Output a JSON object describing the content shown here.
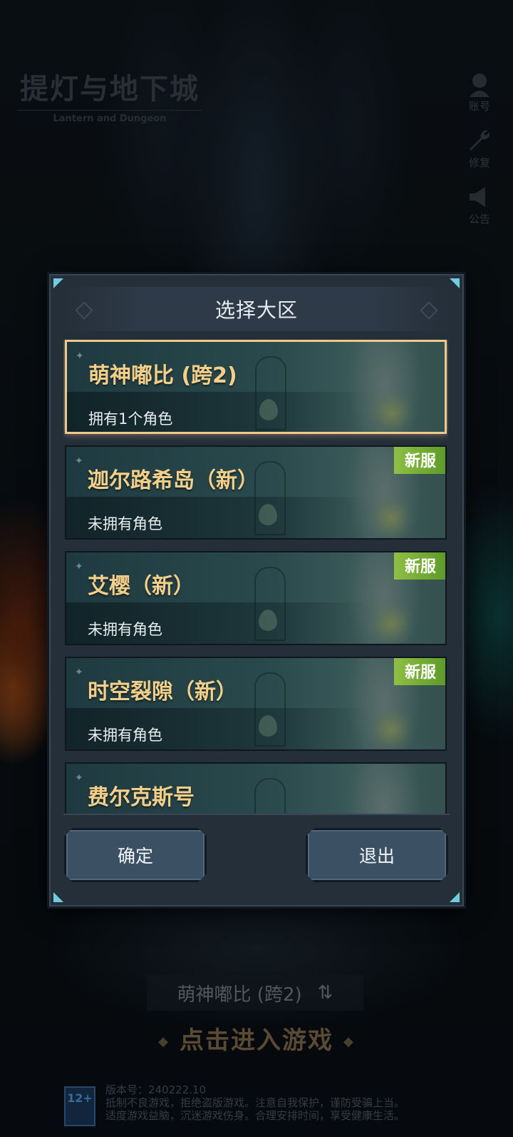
{
  "app": {
    "logo_title": "提灯与地下城",
    "logo_subtitle": "Lantern and Dungeon"
  },
  "side_tools": [
    {
      "label": "账号",
      "icon": "account-icon"
    },
    {
      "label": "修复",
      "icon": "wrench-icon"
    },
    {
      "label": "公告",
      "icon": "speaker-icon"
    }
  ],
  "dialog": {
    "title": "选择大区",
    "servers": [
      {
        "name": "萌神嘟比 (跨2)",
        "status": "拥有1个角色",
        "badge": "",
        "selected": true
      },
      {
        "name": "迦尔路希岛（新）",
        "status": "未拥有角色",
        "badge": "新服",
        "selected": false
      },
      {
        "name": "艾樱（新）",
        "status": "未拥有角色",
        "badge": "新服",
        "selected": false
      },
      {
        "name": "时空裂隙（新）",
        "status": "未拥有角色",
        "badge": "新服",
        "selected": false
      },
      {
        "name": "费尔克斯号",
        "status": "",
        "badge": "",
        "selected": false
      }
    ],
    "confirm_label": "确定",
    "exit_label": "退出"
  },
  "bottom": {
    "current_server": "萌神嘟比 (跨2)",
    "enter_game": "点击进入游戏",
    "age_rating": "12+",
    "version": "版本号：240222.10",
    "notice_line1": "抵制不良游戏，拒绝盗版游戏。注意自我保护，谨防受骗上当。",
    "notice_line2": "适度游戏益脑，沉迷游戏伤身。合理安排时间，享受健康生活。"
  },
  "colors": {
    "server_name": "#f3cf8a",
    "selected_border": "#f0c88a",
    "new_badge": "#7aad38",
    "button_bg": "#3b5163"
  }
}
